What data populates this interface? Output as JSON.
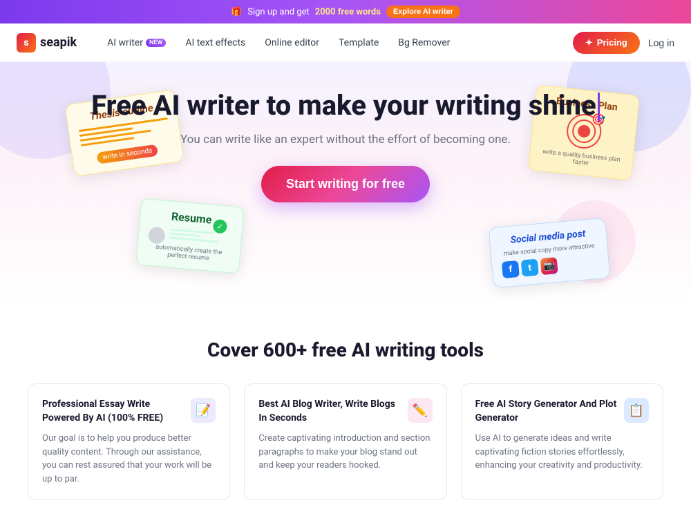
{
  "banner": {
    "gift_icon": "🎁",
    "text": "Sign up and get ",
    "highlight": "2000 free words",
    "btn_label": "Explore AI writer"
  },
  "header": {
    "logo_text": "seapik",
    "nav": [
      {
        "label": "AI writer",
        "badge": "NEW",
        "has_badge": true
      },
      {
        "label": "AI text effects",
        "has_badge": false
      },
      {
        "label": "Online editor",
        "has_badge": false
      },
      {
        "label": "Template",
        "has_badge": false
      },
      {
        "label": "Bg Remover",
        "has_badge": false
      }
    ],
    "pricing_label": "Pricing",
    "login_label": "Log in"
  },
  "hero": {
    "title": "Free AI writer to make your writing shine",
    "subtitle": "You can write like an expert without the effort of becoming one.",
    "cta_label": "Start writing for free"
  },
  "cards": {
    "thesis": {
      "title": "Thesis outline",
      "btn": "write in seconds"
    },
    "business": {
      "title": "Business Plan",
      "subtitle": "write a quality business plan faster"
    },
    "resume": {
      "title": "Resume",
      "subtitle": "automatically create the perfect resume"
    },
    "social": {
      "title": "Social media post",
      "subtitle": "make social copy more attractive"
    }
  },
  "features": {
    "section_title": "Cover 600+ free AI writing tools",
    "items": [
      {
        "title": "Professional Essay Write Powered By AI (100% FREE)",
        "description": "Our goal is to help you produce better quality content. Through our assistance, you can rest assured that your work will be up to par.",
        "icon": "📝",
        "icon_style": "fi-purple"
      },
      {
        "title": "Best AI Blog Writer, Write Blogs In Seconds",
        "description": "Create captivating introduction and section paragraphs to make your blog stand out and keep your readers hooked.",
        "icon": "✏️",
        "icon_style": "fi-pink"
      },
      {
        "title": "Free AI Story Generator And Plot Generator",
        "description": "Use AI to generate ideas and write captivating fiction stories effortlessly, enhancing your creativity and productivity.",
        "icon": "📋",
        "icon_style": "fi-blue"
      }
    ]
  }
}
